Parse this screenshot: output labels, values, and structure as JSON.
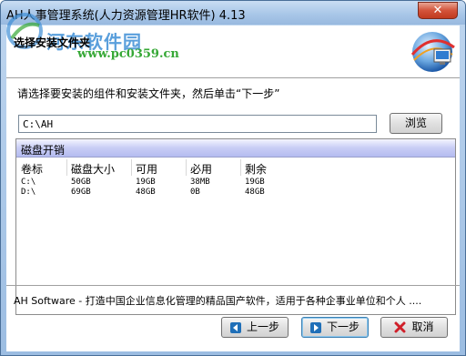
{
  "window": {
    "title": "AH人事管理系统(人力资源管理HR软件) 4.13",
    "close_label": "✕"
  },
  "header": {
    "title": "选择安装文件夹",
    "watermark_brand": "河东软件园",
    "watermark_url": "www.pc0359.cn"
  },
  "instruction": "请选择要安装的组件和安装文件夹，然后单击“下一步”",
  "install_path": {
    "value": "C:\\AH"
  },
  "browse_label": "浏览",
  "disk_space": {
    "title": "磁盘开销",
    "columns": [
      "卷标",
      "磁盘大小",
      "可用",
      "必用",
      "剩余"
    ],
    "rows": [
      [
        "C:\\",
        "50GB",
        "19GB",
        "38MB",
        "19GB"
      ],
      [
        "D:\\",
        "69GB",
        "48GB",
        "0B",
        "48GB"
      ]
    ]
  },
  "footer_text": "AH Software - 打造中国企业信息化管理的精品国产软件，适用于各种企事业单位和个人 ....",
  "buttons": {
    "prev": "上一步",
    "next": "下一步",
    "cancel": "取消"
  },
  "icons": {
    "prev": "arrow-left-icon",
    "next": "arrow-right-icon",
    "cancel": "red-x-icon",
    "header_logo": "installer-globe-icon",
    "watermark_logo": "watermark-logo-icon"
  },
  "colors": {
    "title_bar": "#a9c7e8",
    "close_button": "#c13a1f",
    "disk_header": "#c8cdf5",
    "nav_arrow": "#1f6fb8",
    "cancel_x": "#d0202a"
  }
}
